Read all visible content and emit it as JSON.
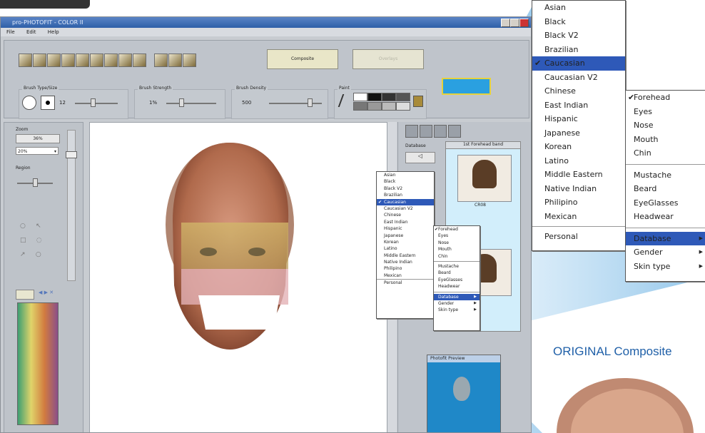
{
  "window": {
    "title": "pro-PHOTOFIT - COLOR II",
    "menu": [
      "File",
      "Edit",
      "Help"
    ]
  },
  "toolbar": {
    "composite_button": "Composite",
    "disabled_button": "Overlays",
    "groups": {
      "brush_type": "Brush Type/Size",
      "brush_size_value": "12",
      "brush_strength": "Brush Strength",
      "brush_strength_value": "1%",
      "brush_density": "Brush Density",
      "brush_density_value": "500",
      "paint": "Paint"
    },
    "color_swatches": [
      "#ffffff",
      "#111111",
      "#333333",
      "#555555",
      "#777777",
      "#999999",
      "#bbbbbb",
      "#dddddd"
    ]
  },
  "left_panel": {
    "zoom_label": "Zoom",
    "zoom_value": "36%",
    "zoom_select": "20%",
    "region_label": "Region"
  },
  "right_panel": {
    "section_label": "Database",
    "list_header": "1st Forehead band",
    "thumb_caption": "CR08",
    "preview_title": "Photofit Preview"
  },
  "ethnicity_menu": {
    "items": [
      "Asian",
      "Black",
      "Black V2",
      "Brazilian",
      "Caucasian",
      "Caucasian V2",
      "Chinese",
      "East Indian",
      "Hispanic",
      "Japanese",
      "Korean",
      "Latino",
      "Middle Eastern",
      "Native Indian",
      "Philipino",
      "Mexican"
    ],
    "selected_index": 4,
    "personal": "Personal"
  },
  "ethnicity_menu_large": {
    "items": [
      "Asian",
      "Black",
      "Black V2",
      "Brazilian",
      "Caucasian",
      "Caucasian V2",
      "Chinese",
      "East Indian",
      "Hispanic",
      "Japanese",
      "Korean",
      "Latino",
      "Middle Eastern",
      "Native Indian",
      "Philipino",
      "Mexican"
    ],
    "selected_index": 4,
    "personal": "Personal"
  },
  "feature_menu": {
    "features": [
      "Forehead",
      "Eyes",
      "Nose",
      "Mouth",
      "Chin"
    ],
    "checked": "Forehead",
    "extras": [
      "Mustache",
      "Beard",
      "EyeGlasses",
      "Headwear"
    ],
    "submenus": [
      "Database",
      "Gender",
      "Skin type"
    ],
    "selected_submenu": "Database"
  },
  "feature_menu_large": {
    "features": [
      "Forehead",
      "Eyes",
      "Nose",
      "Mouth",
      "Chin"
    ],
    "checked": "Forehead",
    "extras": [
      "Mustache",
      "Beard",
      "EyeGlasses",
      "Headwear"
    ],
    "submenus": [
      "Database",
      "Gender",
      "Skin type"
    ],
    "selected_submenu": "Database"
  },
  "callout": {
    "label": "ORIGINAL Composite"
  },
  "colors": {
    "accent": "#2e59b8",
    "callout_blue": "#2060a8"
  }
}
